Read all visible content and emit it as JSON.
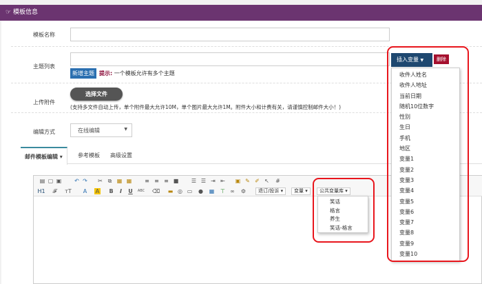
{
  "header": {
    "icon": "hand-point-right-icon",
    "title": "模板信息"
  },
  "form": {
    "name_label": "模板名称",
    "subject_label": "主题列表",
    "new_subject_button": "新增主题",
    "tip_label": "提示:",
    "tip_text": "一个模板允许有多个主题",
    "upload_label": "上传附件",
    "choose_file_button": "选择文件",
    "upload_note": "(支持多文件自动上传，单个附件最大允许10M，单个图片最大允许1M。附件大小和计费有关，请谨慎控制邮件大小！)",
    "edit_mode_label": "编辑方式",
    "edit_mode_value": "在线编辑"
  },
  "tabs": [
    {
      "label": "邮件模板编辑 ▾"
    },
    {
      "label": "参考模板"
    },
    {
      "label": "高级设置"
    }
  ],
  "toolbar": {
    "revise": "退订/投诉",
    "variable": "变量",
    "public_lib": "公共变量库"
  },
  "public_lib_menu": [
    "笑话",
    "格言",
    "养生",
    "笑话-格言"
  ],
  "insert_variable": {
    "button": "插入变量",
    "delete_button": "删除",
    "items": [
      "收件人姓名",
      "收件人地址",
      "当前日期",
      "随机10位数字",
      "性别",
      "生日",
      "手机",
      "地区",
      "变量1",
      "变量2",
      "变量3",
      "变量4",
      "变量5",
      "变量6",
      "变量7",
      "变量8",
      "变量9",
      "变量10"
    ]
  },
  "colors": {
    "header": "#6b3470",
    "highlight": "#e8141b",
    "insert_button": "#1e4870",
    "delete_button": "#a5102e"
  }
}
